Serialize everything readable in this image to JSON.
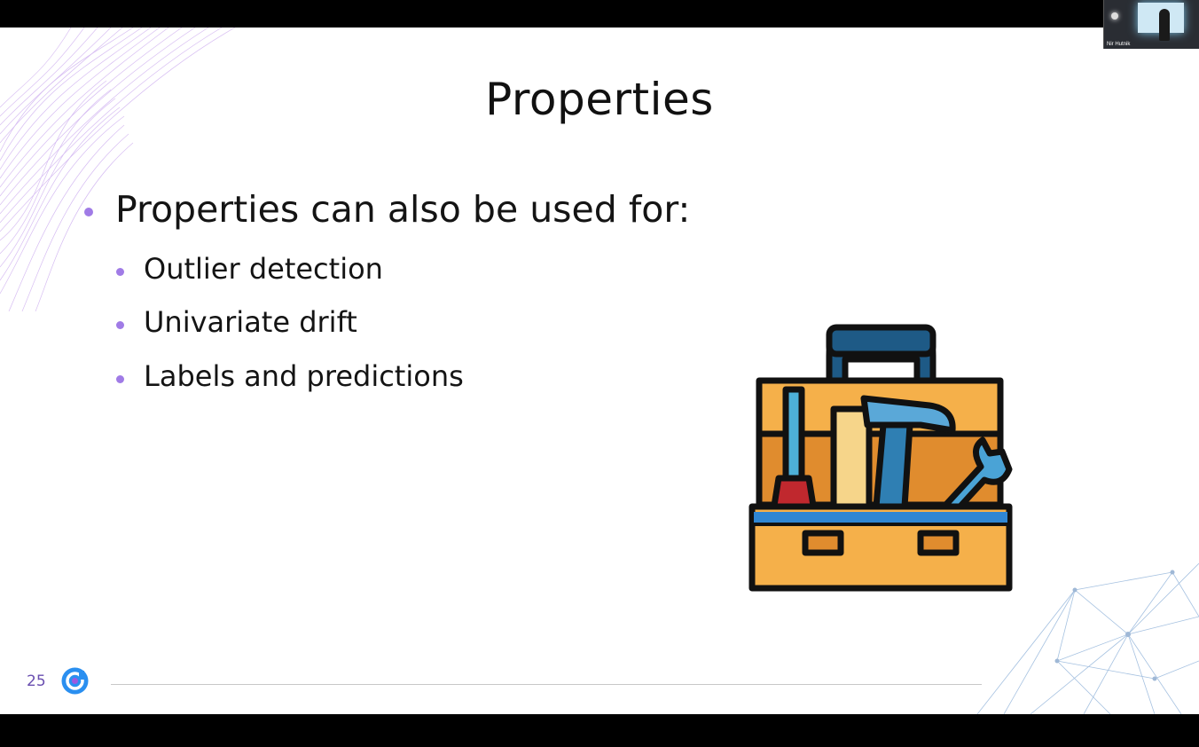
{
  "slide": {
    "title": "Properties",
    "bullets": {
      "main": "Properties can also be used for:",
      "sub": [
        "Outlier detection",
        "Univariate drift",
        "Labels and predictions"
      ]
    },
    "page_number": "25",
    "illustration": "toolbox-icon"
  },
  "webcam": {
    "participant_name": "Nir Hutnik"
  },
  "colors": {
    "bullet": "#a07be6",
    "page_number": "#6a4fb0",
    "logo": "#2a8ff0"
  }
}
